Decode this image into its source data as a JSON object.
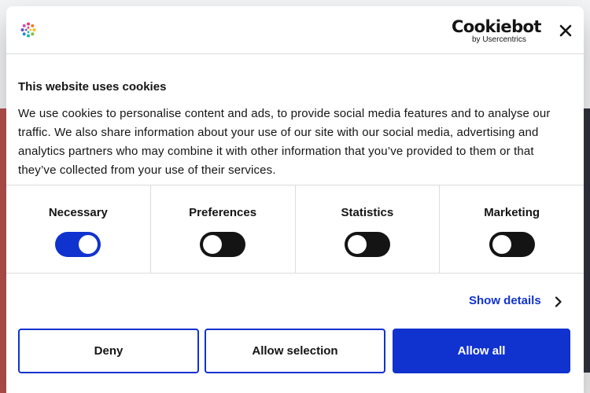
{
  "dialog": {
    "brand_icon": "pinwheel-logo-icon",
    "cookiebot_logo": {
      "word": "Cookiebot",
      "sub": "by Usercentrics"
    },
    "close_icon": "close-icon",
    "title": "This website uses cookies",
    "description": "We use cookies to personalise content and ads, to provide social media features and to analyse our traffic. We also share information about your use of our site with our social media, advertising and analytics partners who may combine it with other information that you’ve provided to them or that they’ve collected from your use of their services."
  },
  "toggles": [
    {
      "label": "Necessary",
      "checked": true
    },
    {
      "label": "Preferences",
      "checked": false
    },
    {
      "label": "Statistics",
      "checked": false
    },
    {
      "label": "Marketing",
      "checked": false
    }
  ],
  "details": {
    "label": "Show details",
    "icon": "chevron-right-icon"
  },
  "buttons": {
    "deny": "Deny",
    "allow_selection": "Allow selection",
    "allow_all": "Allow all"
  },
  "background_nav": {
    "prev_icon": "chevron-left-icon",
    "next_icon": "chevron-right-icon"
  },
  "colors": {
    "accent": "#1032cf",
    "text": "#141414",
    "toggle_off": "#141414",
    "divider": "#dcdcdc"
  }
}
